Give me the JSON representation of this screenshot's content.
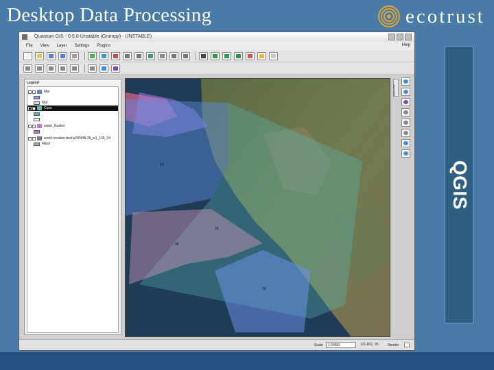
{
  "slide": {
    "title": "Desktop Data Processing",
    "brand_name": "ecotrust",
    "side_label": "QGIS"
  },
  "window": {
    "title": "Quantum GIS - 0.9.0-Unstable (Grumpy) - UNSTABLE)",
    "menus": [
      "File",
      "View",
      "Layer",
      "Settings",
      "Plugins"
    ],
    "help_menu": "Help"
  },
  "legend": {
    "title": "Legend",
    "layers": [
      {
        "name": "Mar",
        "swatch": "#8a8fe0"
      },
      {
        "name": "Mar",
        "swatch": "#dddddd",
        "sub": true
      },
      {
        "name": "Cuse",
        "swatch": "#5bb8a6",
        "selected": true
      },
      {
        "name": "water_Basket",
        "swatch": "#b57fd8"
      },
      {
        "name": "world-location-bnd-p2004fB-25_w1_135_04",
        "swatch": "#7a7a7a"
      },
      {
        "name": "Filled",
        "swatch": "#aaaaaa",
        "sub": true
      }
    ]
  },
  "map": {
    "polygon_labels": [
      "14",
      "36",
      "28",
      "76"
    ]
  },
  "side_tab_label": "Overview",
  "statusbar": {
    "scale_label": "Scale",
    "scale_value": "1:39553",
    "coords": "121.802, 35.",
    "render_label": "Render"
  },
  "colors": {
    "slide_bg": "#4a7aa7",
    "bottom_band": "#27517e",
    "qgis_panel": "#2f5f80"
  },
  "icons": [
    "ecotrust-logo-icon",
    "new-project-icon",
    "open-project-icon",
    "save-icon",
    "zoom-in-icon",
    "zoom-out-icon",
    "pan-icon",
    "identify-icon"
  ]
}
